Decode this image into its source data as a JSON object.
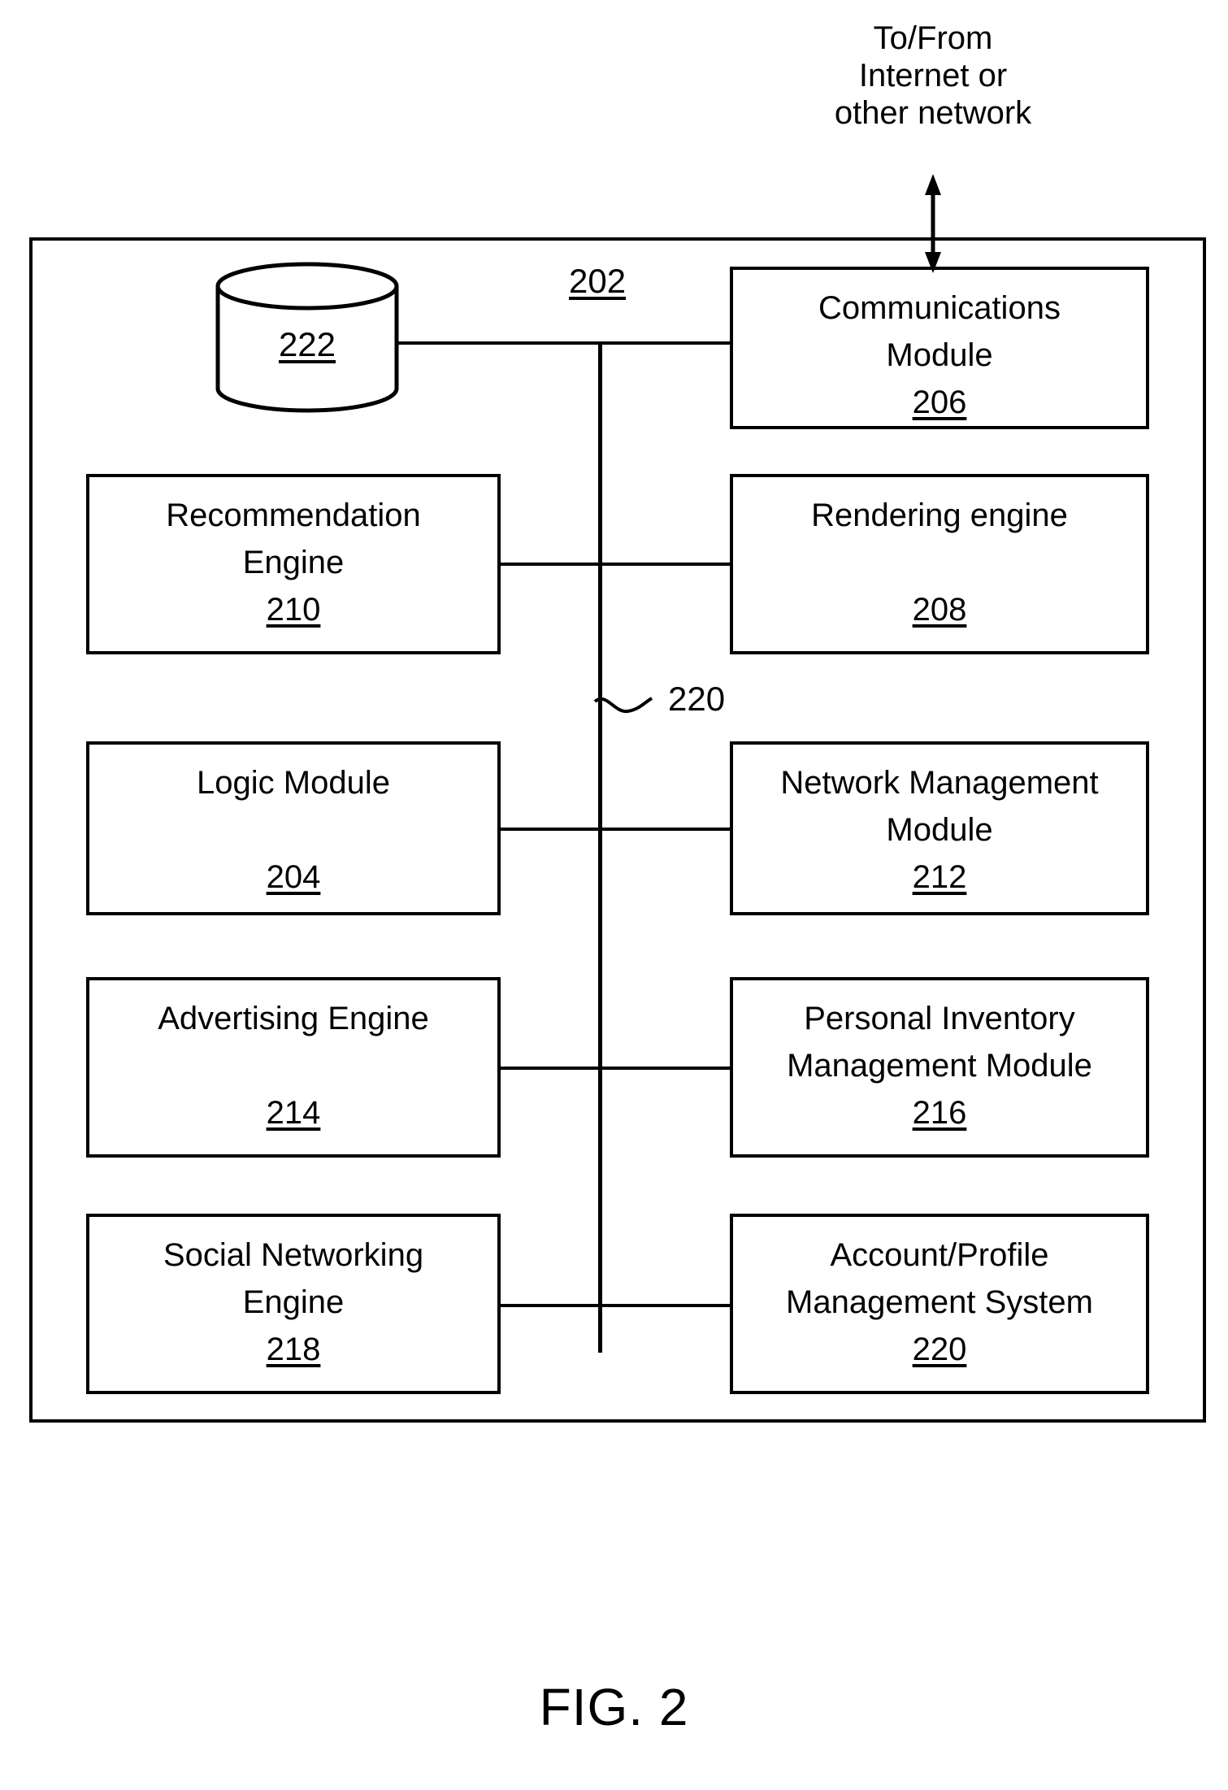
{
  "figure": {
    "caption": "FIG. 2",
    "network_annotation": "To/From\nInternet or\nother network",
    "system_ref": "202",
    "bus_ref": "220"
  },
  "datastore": {
    "ref": "222",
    "shape": "cylinder"
  },
  "modules": {
    "communications": {
      "title": "Communications\nModule",
      "ref": "206"
    },
    "rendering": {
      "title": "Rendering engine",
      "ref": "208"
    },
    "network": {
      "title": "Network Management\nModule",
      "ref": "212"
    },
    "inventory": {
      "title": "Personal Inventory\nManagement Module",
      "ref": "216"
    },
    "account": {
      "title": "Account/Profile\nManagement System",
      "ref": "220"
    },
    "recommendation": {
      "title": "Recommendation\nEngine",
      "ref": "210"
    },
    "logic": {
      "title": "Logic Module",
      "ref": "204"
    },
    "advertising": {
      "title": "Advertising Engine",
      "ref": "214"
    },
    "social": {
      "title": "Social Networking\nEngine",
      "ref": "218"
    }
  },
  "colors": {
    "line": "#000000",
    "background": "#ffffff"
  }
}
